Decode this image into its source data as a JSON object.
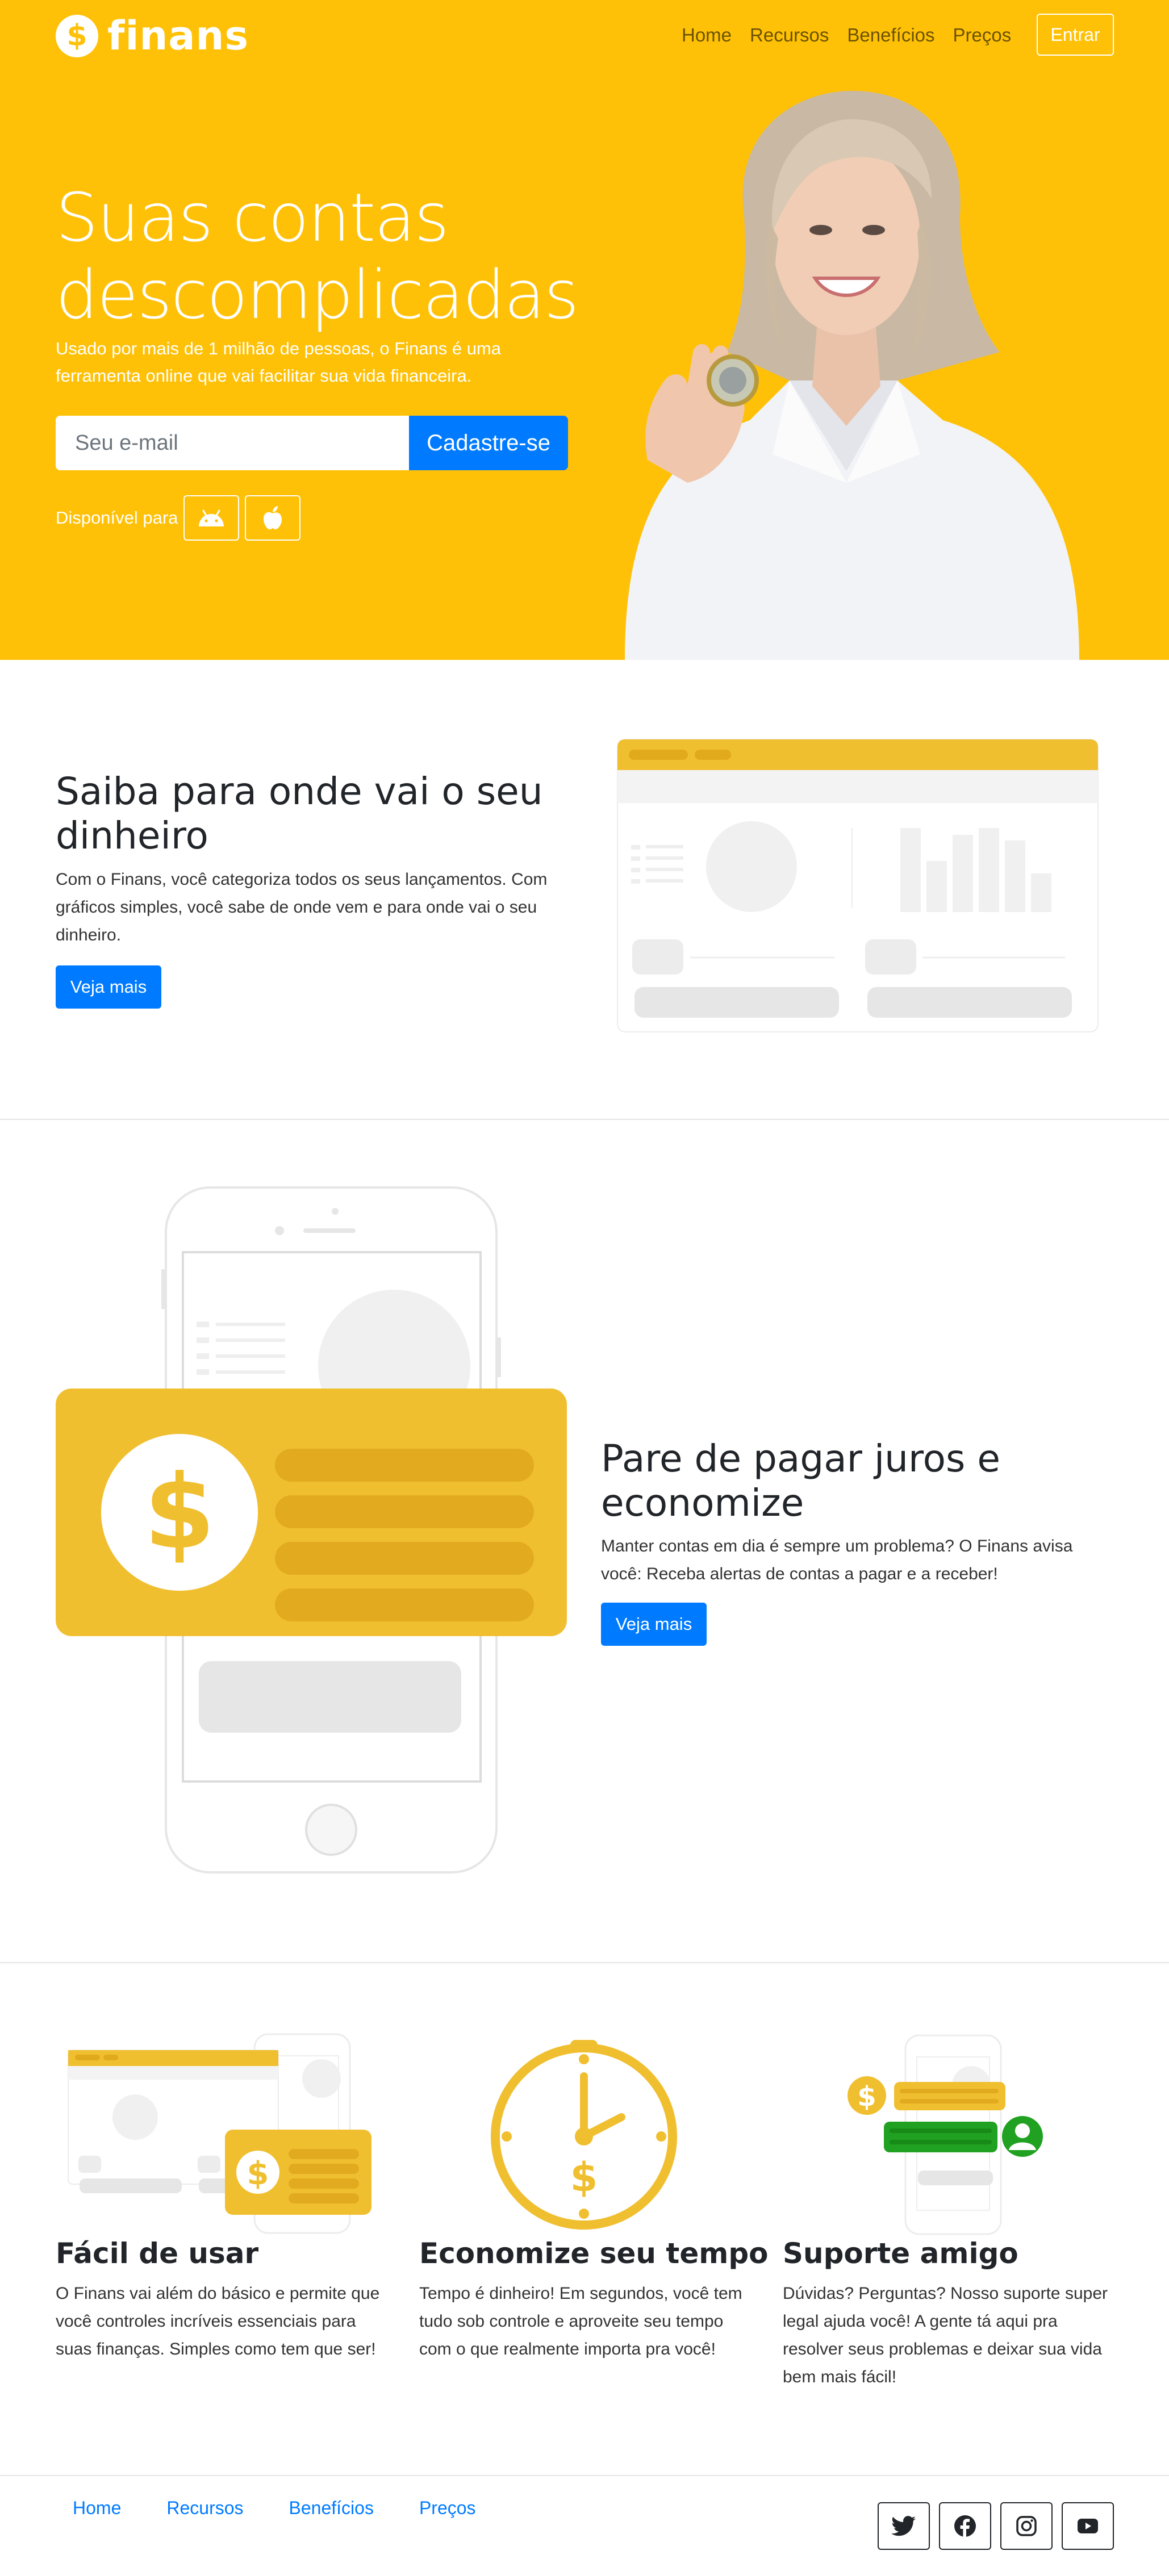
{
  "brand": {
    "logo_glyph": "$",
    "name": "finans"
  },
  "nav": {
    "links": [
      "Home",
      "Recursos",
      "Benefícios",
      "Preços"
    ],
    "enter_label": "Entrar"
  },
  "hero": {
    "title": "Suas contas descomplicadas",
    "subtitle": "Usado por mais de 1 milhão de pessoas, o Finans é uma ferramenta online que vai facilitar sua vida financeira.",
    "email_placeholder": "Seu e-mail",
    "signup_label": "Cadastre-se",
    "available_label": "Disponível para",
    "stores": [
      "android-icon",
      "apple-icon"
    ]
  },
  "section1": {
    "title": "Saiba para onde vai o seu dinheiro",
    "text": "Com o Finans, você categoriza todos os seus lançamentos. Com gráficos simples, você sabe de onde vem e para onde vai o seu dinheiro.",
    "button": "Veja mais"
  },
  "section2": {
    "title": "Pare de pagar juros e economize",
    "text": "Manter contas em dia é sempre um problema? O Finans avisa você: Receba alertas de contas a pagar e a receber!",
    "button": "Veja mais",
    "card_glyph": "$"
  },
  "features": [
    {
      "title": "Fácil de usar",
      "text": "O Finans vai além do básico e permite que você controles incríveis essenciais para suas finanças. Simples como tem que ser!"
    },
    {
      "title": "Economize seu tempo",
      "text": "Tempo é dinheiro! Em segundos, você tem tudo sob controle e aproveite seu tempo com o que realmente importa pra você!"
    },
    {
      "title": "Suporte amigo",
      "text": "Dúvidas? Perguntas? Nosso suporte super legal ajuda você! A gente tá aqui pra resolver seus problemas e deixar sua vida bem mais fácil!"
    }
  ],
  "footer": {
    "links": [
      "Home",
      "Recursos",
      "Benefícios",
      "Preços"
    ],
    "social": [
      "twitter-icon",
      "facebook-icon",
      "instagram-icon",
      "youtube-icon"
    ]
  },
  "colors": {
    "brand_yellow": "#ffc107",
    "card_yellow": "#f0bf30",
    "primary_blue": "#007bff",
    "support_green": "#21a121"
  }
}
